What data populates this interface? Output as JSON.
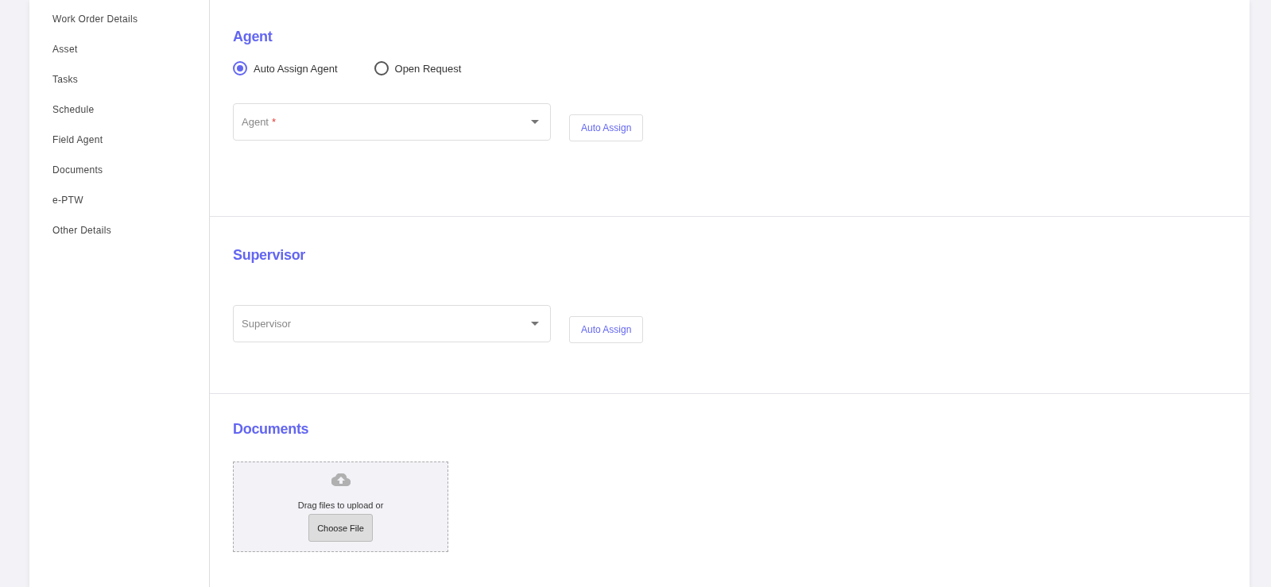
{
  "sidebar": {
    "items": [
      {
        "label": "Work Order Details"
      },
      {
        "label": "Asset"
      },
      {
        "label": "Tasks"
      },
      {
        "label": "Schedule"
      },
      {
        "label": "Field Agent"
      },
      {
        "label": "Documents"
      },
      {
        "label": "e-PTW"
      },
      {
        "label": "Other Details"
      }
    ]
  },
  "sections": [
    {
      "kind": "assign",
      "title": "Agent",
      "radios": [
        {
          "label": "Auto Assign Agent",
          "selected": true
        },
        {
          "label": "Open Request",
          "selected": false
        }
      ],
      "select": {
        "placeholder": "Agent",
        "required_mark": "*"
      },
      "button": "Auto Assign"
    },
    {
      "kind": "assign",
      "title": "Supervisor",
      "select": {
        "placeholder": "Supervisor"
      },
      "button": "Auto Assign"
    },
    {
      "kind": "upload",
      "title": "Documents",
      "hint": "Drag files to upload or",
      "button": "Choose File"
    }
  ]
}
